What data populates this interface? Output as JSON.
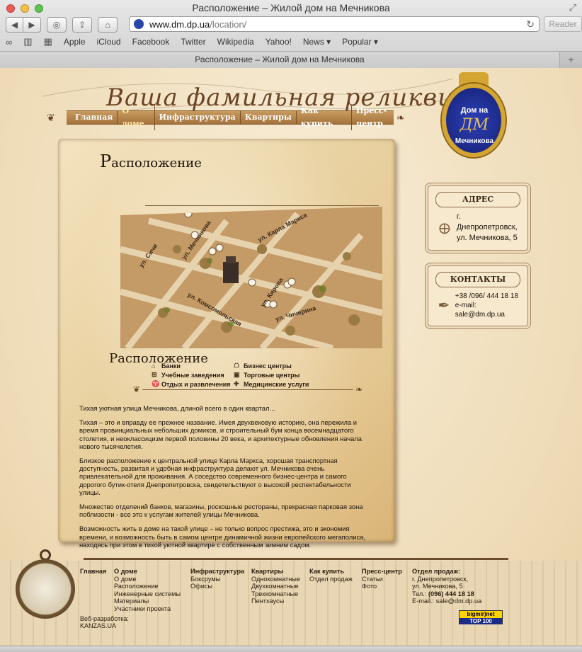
{
  "window": {
    "title": "Расположение – Жилой дом на Мечникова"
  },
  "toolbar": {
    "url_host": "www.dm.dp.ua",
    "url_path": "/location/",
    "reader_label": "Reader"
  },
  "bookmarks": [
    "Apple",
    "iCloud",
    "Facebook",
    "Twitter",
    "Wikipedia",
    "Yahoo!",
    "News ▾",
    "Popular ▾"
  ],
  "tab": {
    "label": "Расположение – Жилой дом на Мечникова"
  },
  "site": {
    "logo_text": "Ваша фамильная реликвия",
    "emblem_line1": "Дом на",
    "emblem_line2": "ДМ",
    "emblem_line3": "Мечникова",
    "menu": [
      {
        "label": "Главная",
        "active": false
      },
      {
        "label": "О доме",
        "active": true
      },
      {
        "label": "Инфраструктура",
        "active": false
      },
      {
        "label": "Квартиры",
        "active": false
      },
      {
        "label": "Как купить",
        "active": false
      },
      {
        "label": "Пресс-центр",
        "active": false
      }
    ]
  },
  "content": {
    "page_title_cap": "Р",
    "page_title_rest": "асположение",
    "streets": [
      "ул. Карла Маркса",
      "ул. Сичи",
      "ул. Мечникова",
      "ул. Кирова",
      "ул. Комсомольская",
      "ул. Чичерина"
    ],
    "legend_title": "Расположение",
    "legend": [
      [
        "Банки",
        "Бизнес центры"
      ],
      [
        "Учебные заведения",
        "Торговые центры"
      ],
      [
        "Отдых и развлечения",
        "Медицинские услуги"
      ]
    ],
    "paragraphs": [
      "Тихая уютная улица Мечникова, длиной всего в один квартал...",
      "Тихая – это и вправду ее прежнее название. Имея двухвековую историю, она пережила и время провинциальных небольших домиков, и строительный бум конца восемнадцатого столетия, и неоклассицизм первой половины 20 века, и архитектурные обновления начала нового тысячелетия.",
      "Близкое расположение к центральной улице Карла Маркса, хорошая транспортная доступность, развитая и удобная инфраструктура делают ул. Мечникова очень привлекательной для проживания. А соседство современного бизнес-центра и самого дорогого бутик-отеля Днепропетровска, свидетельствуют о высокой респектабельности улицы.",
      "Множество отделений банков, магазины, роскошные рестораны, прекрасная парковая зона поблизости - все это к услугам жителей улицы Мечникова.",
      "Возможность жить в доме на такой улице – не только вопрос престижа, это и экономия времени, и возможность быть в самом центре динамичной жизни европейского мегаполиса, находясь при этом в тихой уютной квартире с собственным зимним садом."
    ]
  },
  "sidebar": {
    "address_title": "АДРЕС",
    "address_line1": "г. Днепропетровск,",
    "address_line2": "ул. Мечникова, 5",
    "contacts_title": "КОНТАКТЫ",
    "phone": "+38 /096/ 444 18 18",
    "email": "e-mail: sale@dm.dp.ua"
  },
  "footer": {
    "columns": [
      {
        "head": "Главная",
        "items": []
      },
      {
        "head": "О доме",
        "items": [
          "О доме",
          "Расположение",
          "Инженерные системы",
          "Материалы",
          "Участники проекта"
        ]
      },
      {
        "head": "Инфраструктура",
        "items": [
          "Боксрумы",
          "Офисы"
        ]
      },
      {
        "head": "Квартиры",
        "items": [
          "Однокомнатные",
          "Двухкомнатные",
          "Трехкомнатные",
          "Пентхаусы"
        ]
      },
      {
        "head": "Как купить",
        "items": [
          "Отдел продаж"
        ]
      },
      {
        "head": "Пресс-центр",
        "items": [
          "Статьи",
          "Фото"
        ]
      }
    ],
    "sales_head": "Отдел продаж:",
    "sales_line1": "г. Днепропетровск,",
    "sales_line2": "ул. Мечникова, 5",
    "sales_phone_label": "Тел.: ",
    "sales_phone": "(096) 444 18 18",
    "sales_email": "E-mail.: sale@dm.dp.ua",
    "dev_label": "Веб-разработка:",
    "dev_name": "KANZAS.UA",
    "counter_top": "bigmir)net",
    "counter_bottom": "TOP 100"
  }
}
